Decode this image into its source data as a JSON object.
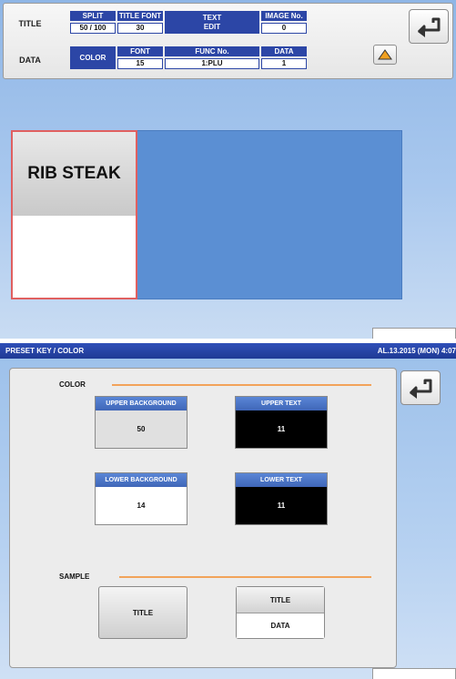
{
  "top_screen": {
    "rows": {
      "title_label": "TITLE",
      "data_label": "DATA"
    },
    "split": {
      "label": "SPLIT",
      "value": "50 / 100"
    },
    "title_font": {
      "label": "TITLE FONT",
      "value": "30"
    },
    "text_edit": {
      "line1": "TEXT",
      "line2": "EDIT"
    },
    "image_no": {
      "label": "IMAGE No.",
      "value": "0"
    },
    "color_button": "COLOR",
    "font": {
      "label": "FONT",
      "value": "15"
    },
    "func_no": {
      "label": "FUNC No.",
      "value": "1:PLU"
    },
    "data_field": {
      "label": "DATA",
      "value": "1"
    },
    "preset_key": {
      "title": "RIB STEAK"
    },
    "colors": {
      "accent": "#2c46a6",
      "key_area": "#5b8fd3",
      "selected_border": "#e06060"
    }
  },
  "bottom_screen": {
    "status": {
      "title": "PRESET KEY / COLOR",
      "date": "AL.13.2015 (MON)  4:07"
    },
    "color_section": {
      "label": "COLOR",
      "upper_background": {
        "label": "UPPER BACKGROUND",
        "value": "50"
      },
      "upper_text": {
        "label": "UPPER TEXT",
        "value": "11"
      },
      "lower_background": {
        "label": "LOWER BACKGROUND",
        "value": "14"
      },
      "lower_text": {
        "label": "LOWER TEXT",
        "value": "11"
      }
    },
    "sample_section": {
      "label": "SAMPLE",
      "single_title": "TITLE",
      "split_title": "TITLE",
      "split_data": "DATA"
    },
    "colors": {
      "divider": "#f2a35a",
      "header": "#3f66b8"
    }
  }
}
